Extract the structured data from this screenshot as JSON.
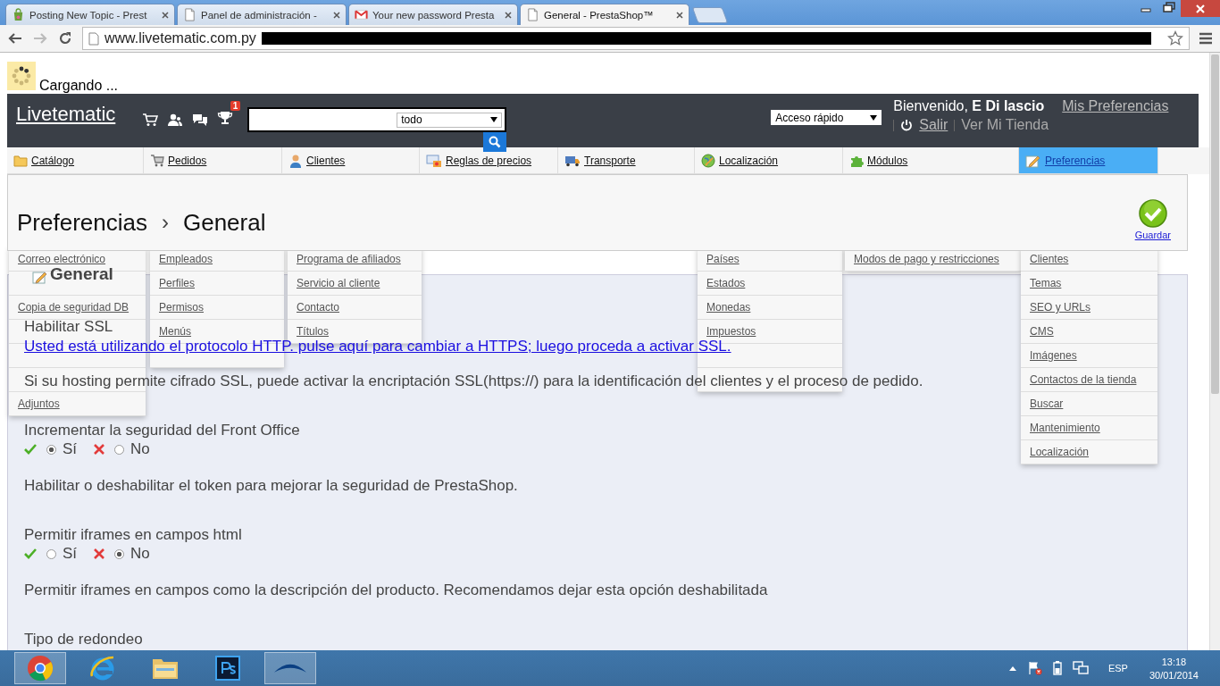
{
  "browser": {
    "tabs": [
      {
        "title": "Posting New Topic - Prest",
        "selected": false
      },
      {
        "title": "Panel de administración -",
        "selected": false
      },
      {
        "title": "Your new password Presta",
        "selected": false
      },
      {
        "title": "General - PrestaShop™",
        "selected": true
      }
    ],
    "address": "www.livetematic.com.py"
  },
  "loading": {
    "text": "Cargando ..."
  },
  "header": {
    "logo": "Livetematic",
    "badge": "1",
    "search_scope": "todo",
    "quick_access": "Acceso rápido",
    "welcome": "Bienvenido,",
    "user": "E Di lascio",
    "preferences_link": "Mis Preferencias",
    "logout": "Salir",
    "shop_link": "Ver Mi Tienda"
  },
  "nav": [
    {
      "label": "Catálogo",
      "selected": false
    },
    {
      "label": "Pedidos",
      "selected": false
    },
    {
      "label": "Clientes",
      "selected": false
    },
    {
      "label": "Reglas de precios",
      "selected": false
    },
    {
      "label": "Transporte",
      "selected": false
    },
    {
      "label": "Localización",
      "selected": false
    },
    {
      "label": "Módulos",
      "selected": false
    },
    {
      "label": "Preferencias",
      "selected": true
    }
  ],
  "toolbar": {
    "breadcrumb": [
      "Preferencias",
      "General"
    ],
    "separator": "›",
    "save": "Guardar"
  },
  "dropdowns": [
    {
      "items": [
        "Correo electrónico",
        "Copia de seguridad DB",
        "Adjuntos"
      ]
    },
    {
      "items": [
        "Empleados",
        "Perfiles",
        "Permisos",
        "Menús"
      ]
    },
    {
      "items": [
        "Programa de afiliados",
        "Servicio al cliente",
        "Contacto",
        "Títulos"
      ]
    },
    {
      "items": [
        "Países",
        "Estados",
        "Monedas",
        "Impuestos"
      ]
    },
    {
      "items": [
        "Modos de pago y restricciones"
      ]
    },
    {
      "items": [
        "Clientes",
        "Temas",
        "SEO y URLs",
        "CMS",
        "Imágenes",
        "Contactos de la tienda",
        "Buscar",
        "Mantenimiento",
        "Localización"
      ]
    }
  ],
  "content": {
    "title": "General",
    "blocks": [
      {
        "kind": "label",
        "text": "Habilitar SSL"
      },
      {
        "kind": "link",
        "text": "Usted está utilizando el protocolo HTTP. pulse aquí para cambiar a HTTPS; luego proceda a activar SSL."
      },
      {
        "kind": "help",
        "text": "Si su hosting permite cifrado SSL, puede activar la encriptación SSL(https://) para la identificación del clientes y el proceso de pedido."
      },
      {
        "kind": "label",
        "text": "Incrementar la seguridad del Front Office"
      },
      {
        "kind": "radio",
        "options": [
          {
            "kind": "yes",
            "label": "Sí",
            "selected": true
          },
          {
            "kind": "no",
            "label": "No",
            "selected": false
          }
        ]
      },
      {
        "kind": "help",
        "text": "Habilitar o deshabilitar el token para mejorar la seguridad de PrestaShop."
      },
      {
        "kind": "label",
        "text": "Permitir iframes en campos html"
      },
      {
        "kind": "radio",
        "options": [
          {
            "kind": "yes",
            "label": "Sí",
            "selected": false
          },
          {
            "kind": "no",
            "label": "No",
            "selected": true
          }
        ]
      },
      {
        "kind": "help",
        "text": "Permitir iframes en campos como la descripción del producto. Recomendamos dejar esta opción deshabilitada"
      },
      {
        "kind": "label",
        "text": "Tipo de redondeo"
      }
    ]
  },
  "taskbar": {
    "apps": [
      {
        "active": true
      },
      {
        "active": false
      },
      {
        "active": false
      },
      {
        "active": false
      },
      {
        "active": true
      }
    ],
    "language": "ESP",
    "time": "13:18",
    "date": "30/01/2014"
  }
}
